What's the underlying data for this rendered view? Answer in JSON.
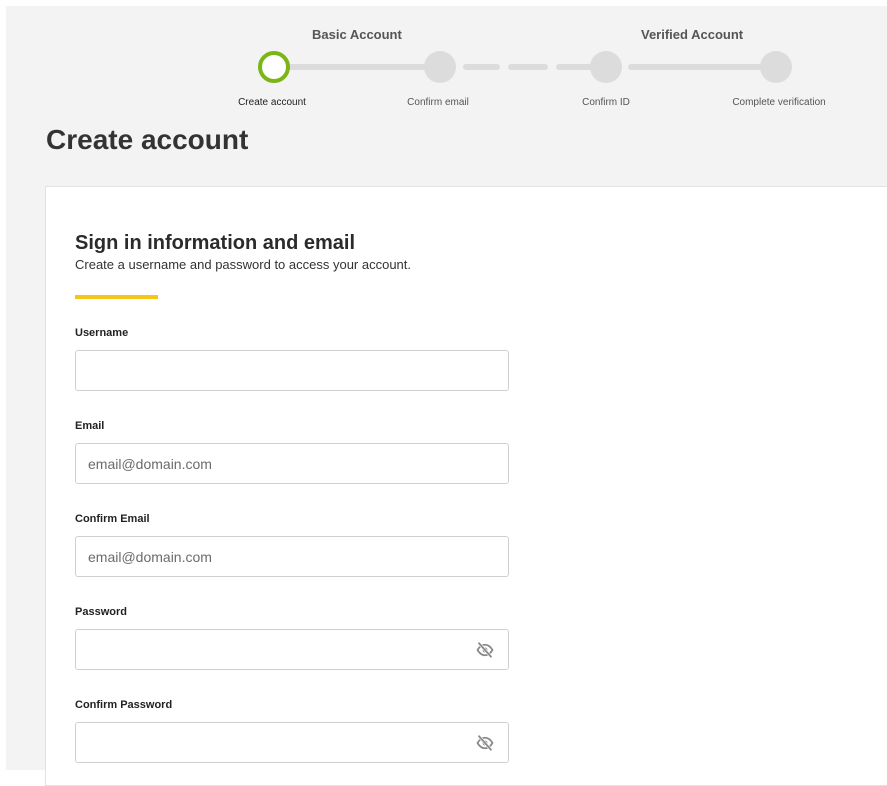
{
  "stepper": {
    "groups": {
      "basic": "Basic Account",
      "verified": "Verified Account"
    },
    "steps": [
      {
        "label": "Create account",
        "state": "active"
      },
      {
        "label": "Confirm email",
        "state": "pending"
      },
      {
        "label": "Confirm ID",
        "state": "pending"
      },
      {
        "label": "Complete verification",
        "state": "pending"
      }
    ]
  },
  "page": {
    "title": "Create account"
  },
  "section": {
    "title": "Sign in information and email",
    "subtitle": "Create a username and password to access your account."
  },
  "form": {
    "username": {
      "label": "Username",
      "placeholder": "",
      "value": ""
    },
    "email": {
      "label": "Email",
      "placeholder": "email@domain.com",
      "value": ""
    },
    "confirm_email": {
      "label": "Confirm Email",
      "placeholder": "email@domain.com",
      "value": ""
    },
    "password": {
      "label": "Password",
      "placeholder": "",
      "value": "",
      "icon": "eye-slash-icon"
    },
    "confirm_password": {
      "label": "Confirm Password",
      "placeholder": "",
      "value": "",
      "icon": "eye-slash-icon"
    }
  },
  "colors": {
    "accent_green": "#7cb518",
    "accent_yellow": "#f5c518",
    "page_bg": "#f3f3f3",
    "step_inactive": "#dcdcdc"
  }
}
